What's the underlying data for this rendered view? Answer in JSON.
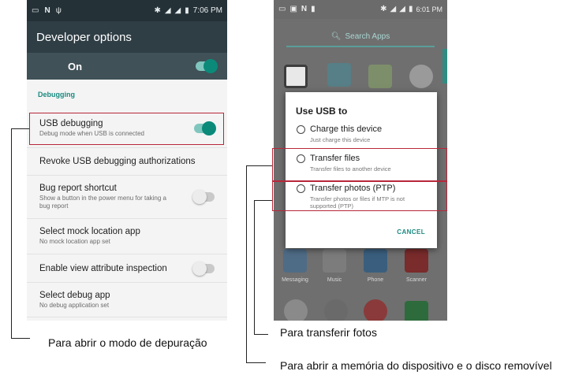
{
  "left_phone": {
    "status": {
      "time": "7:06 PM",
      "icons_left": [
        "battery-icon",
        "n-icon",
        "signal-small-icon"
      ],
      "icons_right": [
        "bluetooth-icon",
        "signal-icon",
        "signal-icon-2",
        "battery-icon"
      ]
    },
    "title": "Developer options",
    "master_switch": {
      "label": "On",
      "state": "on"
    },
    "section": "Debugging",
    "items": [
      {
        "title": "USB debugging",
        "subtitle": "Debug mode when USB is connected",
        "toggle": "on"
      },
      {
        "title": "Revoke USB debugging authorizations",
        "subtitle": ""
      },
      {
        "title": "Bug report shortcut",
        "subtitle": "Show a button in the power menu for taking a bug report",
        "toggle": "off"
      },
      {
        "title": "Select mock location app",
        "subtitle": "No mock location app set"
      },
      {
        "title": "Enable view attribute inspection",
        "subtitle": "",
        "toggle": "off"
      },
      {
        "title": "Select debug app",
        "subtitle": "No debug application set"
      }
    ]
  },
  "right_phone": {
    "status": {
      "time": "6:01 PM"
    },
    "search_placeholder": "Search Apps",
    "dock": [
      "Messaging",
      "Music",
      "Phone",
      "Scanner"
    ],
    "dialog": {
      "title": "Use USB to",
      "options": [
        {
          "label": "Charge this device",
          "desc": "Just charge this device"
        },
        {
          "label": "Transfer files",
          "desc": "Transfer files to another device"
        },
        {
          "label": "Transfer photos (PTP)",
          "desc": "Transfer photos or files if MTP is not supported (PTP)"
        }
      ],
      "cancel": "CANCEL"
    }
  },
  "captions": {
    "debug": "Para abrir o modo de depuração",
    "photos": "Para transferir fotos",
    "memory": "Para abrir a memória do dispositivo e o disco removível"
  },
  "colors": {
    "accent": "#0b8a7a",
    "highlight": "#b8263a",
    "appbar": "#2f3e45"
  }
}
